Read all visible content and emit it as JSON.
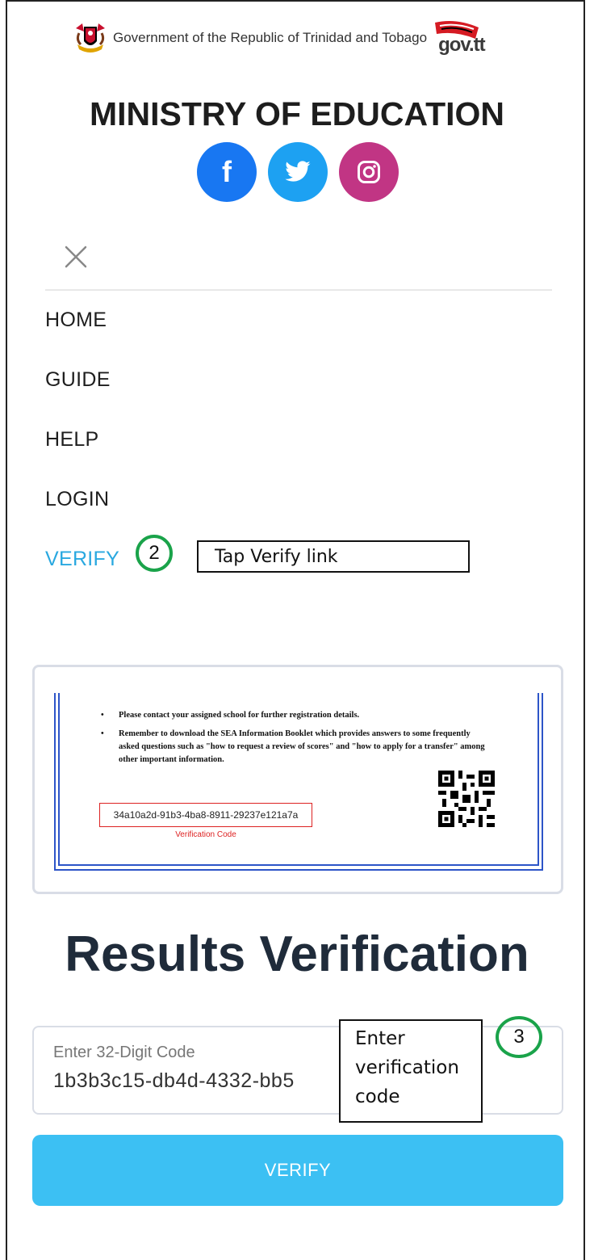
{
  "header": {
    "gov_text": "Government of the Republic of Trinidad and Tobago",
    "govtt_text": "gov.tt",
    "ministry": "MINISTRY OF EDUCATION"
  },
  "socials": [
    {
      "name": "facebook",
      "glyph": "f",
      "color": "#1877f2"
    },
    {
      "name": "twitter",
      "glyph": "🐦",
      "color": "#1da1f2"
    },
    {
      "name": "instagram",
      "glyph": "◎",
      "color": "#c13584"
    }
  ],
  "nav": {
    "items": [
      {
        "label": "HOME"
      },
      {
        "label": "GUIDE"
      },
      {
        "label": "HELP"
      },
      {
        "label": "LOGIN"
      },
      {
        "label": "VERIFY"
      }
    ]
  },
  "annotations": {
    "step2": "2",
    "step2_text": "Tap Verify link",
    "step3": "3",
    "step3_text": "Enter verification code"
  },
  "sample": {
    "bullet1": "Please contact your assigned school for further registration details.",
    "bullet2": "Remember to download the SEA Information Booklet which provides answers to some frequently asked questions such as \"how to request a review of scores\" and \"how to apply for a transfer\" among other important information.",
    "code": "34a10a2d-91b3-4ba8-8911-29237e121a7a",
    "code_label": "Verification Code"
  },
  "verification": {
    "title": "Results Verification",
    "input_label": "Enter 32-Digit Code",
    "input_value": "1b3b3c15-db4d-4332-bb5                    837",
    "button_label": "VERIFY"
  },
  "colors": {
    "accent": "#3cc0f3",
    "verify_link": "#29a8e0",
    "step_circle": "#1aa34a"
  }
}
